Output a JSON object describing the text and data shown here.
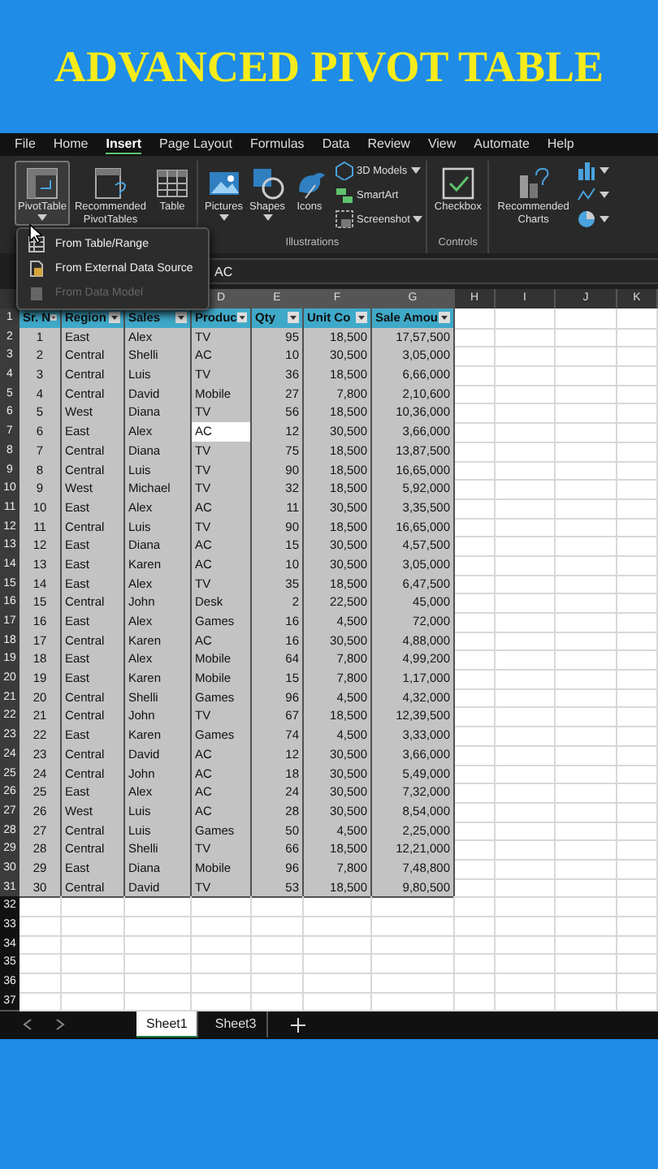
{
  "banner": {
    "title": "ADVANCED PIVOT TABLE"
  },
  "menu": [
    {
      "label": "File",
      "selected": false
    },
    {
      "label": "Home",
      "selected": false
    },
    {
      "label": "Insert",
      "selected": true
    },
    {
      "label": "Page Layout",
      "selected": false
    },
    {
      "label": "Formulas",
      "selected": false
    },
    {
      "label": "Data",
      "selected": false
    },
    {
      "label": "Review",
      "selected": false
    },
    {
      "label": "View",
      "selected": false
    },
    {
      "label": "Automate",
      "selected": false
    },
    {
      "label": "Help",
      "selected": false
    }
  ],
  "ribbon": {
    "groups": [
      {
        "buttons": [
          {
            "kind": "pivot",
            "label": "PivotTable",
            "dropdown": true,
            "selected": true
          },
          {
            "kind": "recommended-pivot",
            "label": "Recommended PivotTables",
            "dropdown": false,
            "selected": false
          },
          {
            "kind": "table",
            "label": "Table",
            "dropdown": false,
            "selected": false
          }
        ]
      },
      {
        "label": "Illustrations",
        "buttons": [
          {
            "kind": "pictures",
            "label": "Pictures",
            "dropdown": true,
            "selected": false
          },
          {
            "kind": "shapes",
            "label": "Shapes",
            "dropdown": true,
            "selected": false
          },
          {
            "kind": "icons",
            "label": "Icons",
            "dropdown": false,
            "selected": false
          }
        ],
        "small_buttons": [
          {
            "kind": "cube",
            "label": "3D Models",
            "dropdown": true
          },
          {
            "kind": "smartart",
            "label": "SmartArt",
            "dropdown": false
          },
          {
            "kind": "screenshot",
            "label": "Screenshot",
            "dropdown": true
          }
        ]
      },
      {
        "label": "Controls",
        "buttons": [
          {
            "kind": "checkbox",
            "label": "Checkbox",
            "dropdown": false,
            "selected": false
          }
        ]
      },
      {
        "buttons": [
          {
            "kind": "recommended-charts",
            "label": "Recommended Charts",
            "dropdown": false,
            "selected": false
          }
        ],
        "small_buttons": [
          {
            "kind": "bar-chart",
            "dropdown": true
          },
          {
            "kind": "line-chart",
            "dropdown": true
          },
          {
            "kind": "pie-chart",
            "dropdown": true
          }
        ]
      }
    ]
  },
  "pivot_menu": {
    "items": [
      {
        "kind": "table",
        "label": "From Table/Range",
        "disabled": false
      },
      {
        "kind": "external",
        "label": "From External Data Source",
        "disabled": false
      },
      {
        "kind": "model",
        "label": "From Data Model",
        "disabled": true
      }
    ]
  },
  "formula_bar": {
    "value": "AC"
  },
  "sheet": {
    "column_headers": [
      "D",
      "E",
      "F",
      "G",
      "H",
      "I",
      "J",
      "K"
    ],
    "row_numbers": [
      "1",
      "2",
      "3",
      "4",
      "5",
      "6",
      "7",
      "8",
      "9",
      "10",
      "11",
      "12",
      "13",
      "14",
      "15",
      "16",
      "17",
      "18",
      "19",
      "20",
      "21",
      "22",
      "23",
      "24",
      "25",
      "26",
      "27",
      "28",
      "29",
      "30",
      "31",
      "32",
      "33",
      "34",
      "35",
      "36",
      "37"
    ],
    "header": [
      "Sr. N",
      "Region",
      "Sales",
      "Produc",
      "Qty",
      "Unit Co",
      "Sale Amou"
    ],
    "rows": [
      [
        "1",
        "East",
        "Alex",
        "TV",
        "95",
        "18,500",
        "17,57,500"
      ],
      [
        "2",
        "Central",
        "Shelli",
        "AC",
        "10",
        "30,500",
        "3,05,000"
      ],
      [
        "3",
        "Central",
        "Luis",
        "TV",
        "36",
        "18,500",
        "6,66,000"
      ],
      [
        "4",
        "Central",
        "David",
        "Mobile",
        "27",
        "7,800",
        "2,10,600"
      ],
      [
        "5",
        "West",
        "Diana",
        "TV",
        "56",
        "18,500",
        "10,36,000"
      ],
      [
        "6",
        "East",
        "Alex",
        {
          "text": "AC",
          "active": true
        },
        "12",
        "30,500",
        "3,66,000"
      ],
      [
        "7",
        "Central",
        "Diana",
        "TV",
        "75",
        "18,500",
        "13,87,500"
      ],
      [
        "8",
        "Central",
        "Luis",
        "TV",
        "90",
        "18,500",
        "16,65,000"
      ],
      [
        "9",
        "West",
        "Michael",
        "TV",
        "32",
        "18,500",
        "5,92,000"
      ],
      [
        "10",
        "East",
        "Alex",
        "AC",
        "11",
        "30,500",
        "3,35,500"
      ],
      [
        "11",
        "Central",
        "Luis",
        "TV",
        "90",
        "18,500",
        "16,65,000"
      ],
      [
        "12",
        "East",
        "Diana",
        "AC",
        "15",
        "30,500",
        "4,57,500"
      ],
      [
        "13",
        "East",
        "Karen",
        "AC",
        "10",
        "30,500",
        "3,05,000"
      ],
      [
        "14",
        "East",
        "Alex",
        "TV",
        "35",
        "18,500",
        "6,47,500"
      ],
      [
        "15",
        "Central",
        "John",
        "Desk",
        "2",
        "22,500",
        "45,000"
      ],
      [
        "16",
        "East",
        "Alex",
        "Games",
        "16",
        "4,500",
        "72,000"
      ],
      [
        "17",
        "Central",
        "Karen",
        "AC",
        "16",
        "30,500",
        "4,88,000"
      ],
      [
        "18",
        "East",
        "Alex",
        "Mobile",
        "64",
        "7,800",
        "4,99,200"
      ],
      [
        "19",
        "East",
        "Karen",
        "Mobile",
        "15",
        "7,800",
        "1,17,000"
      ],
      [
        "20",
        "Central",
        "Shelli",
        "Games",
        "96",
        "4,500",
        "4,32,000"
      ],
      [
        "21",
        "Central",
        "John",
        "TV",
        "67",
        "18,500",
        "12,39,500"
      ],
      [
        "22",
        "East",
        "Karen",
        "Games",
        "74",
        "4,500",
        "3,33,000"
      ],
      [
        "23",
        "Central",
        "David",
        "AC",
        "12",
        "30,500",
        "3,66,000"
      ],
      [
        "24",
        "Central",
        "John",
        "AC",
        "18",
        "30,500",
        "5,49,000"
      ],
      [
        "25",
        "East",
        "Alex",
        "AC",
        "24",
        "30,500",
        "7,32,000"
      ],
      [
        "26",
        "West",
        "Luis",
        "AC",
        "28",
        "30,500",
        "8,54,000"
      ],
      [
        "27",
        "Central",
        "Luis",
        "Games",
        "50",
        "4,500",
        "2,25,000"
      ],
      [
        "28",
        "Central",
        "Shelli",
        "TV",
        "66",
        "18,500",
        "12,21,000"
      ],
      [
        "29",
        "East",
        "Diana",
        "Mobile",
        "96",
        "7,800",
        "7,48,800"
      ],
      [
        "30",
        "Central",
        "David",
        "TV",
        "53",
        "18,500",
        "9,80,500"
      ]
    ]
  },
  "sheet_tabs": [
    {
      "label": "Sheet1",
      "selected": true
    },
    {
      "label": "Sheet3",
      "selected": false
    }
  ]
}
